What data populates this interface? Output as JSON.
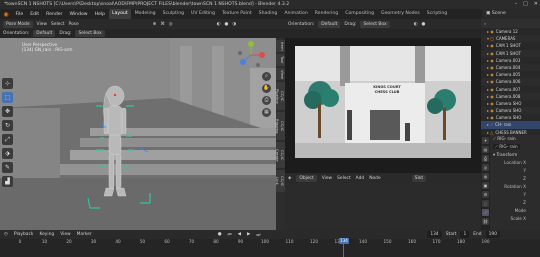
{
  "window": {
    "title": "*townSCN 1 NSHOTS [C:\\Users\\P\\Desktop\\snoal\\AOD\\FMP\\PROJECT FILES\\blender\\townSCN 1 NSHOTS.blend] - Blender 4.3.2",
    "controls": [
      "–",
      "□",
      "✕"
    ]
  },
  "menubar": {
    "items": [
      "File",
      "Edit",
      "Render",
      "Window",
      "Help"
    ],
    "workspaces": [
      "Layout",
      "Modeling",
      "Sculpting",
      "UV Editing",
      "Texture Paint",
      "Shading",
      "Animation",
      "Rendering",
      "Compositing",
      "Geometry Nodes",
      "Scripting"
    ],
    "active_workspace": "Layout",
    "scene_label": "Scene"
  },
  "viewport": {
    "mode": "Pose Mode",
    "menus": [
      "View",
      "Select",
      "Pose"
    ],
    "orientation_label": "Orientation:",
    "orientation_value": "Default",
    "drag_label": "Drag:",
    "drag_value": "Select Box",
    "info_line1": "User Perspective",
    "info_line2": "(134) GN_rain : RIG-arm",
    "n_tabs": [
      "Item",
      "Tool",
      "View",
      "CC/iC Pipeline",
      "CC/iC Rigging",
      "CC/iC Create",
      "CC/iC Link"
    ]
  },
  "camera_view": {
    "orientation_label": "Orientation:",
    "orientation_value": "Default",
    "drag_label": "Drag:",
    "drag_value": "Select Box",
    "sign_line1": "KINGS COURT",
    "sign_line2": "CHESS CLUB"
  },
  "node_editor": {
    "mode": "Object",
    "menus": [
      "View",
      "Select",
      "Add",
      "Node"
    ],
    "slot": "Slot"
  },
  "outliner": {
    "search_placeholder": "",
    "rows": [
      {
        "label": "Camera 12",
        "icon": "camera-icon"
      },
      {
        "label": "CAMERAS",
        "icon": "collection-icon"
      },
      {
        "label": "CAM 1 SHOT",
        "icon": "camera-icon"
      },
      {
        "label": "CAM 1 SHOT",
        "icon": "camera-icon"
      },
      {
        "label": "Camera.003",
        "icon": "camera-icon"
      },
      {
        "label": "Camera.004",
        "icon": "camera-icon"
      },
      {
        "label": "Camera.005",
        "icon": "camera-icon"
      },
      {
        "label": "Camera.006",
        "icon": "camera-icon"
      },
      {
        "label": "Camera.007",
        "icon": "camera-icon"
      },
      {
        "label": "Camera.008",
        "icon": "camera-icon"
      },
      {
        "label": "Camera SHO",
        "icon": "camera-icon"
      },
      {
        "label": "Camera SHO",
        "icon": "camera-icon"
      },
      {
        "label": "Camera SHO",
        "icon": "camera-icon"
      },
      {
        "label": "CH- rain",
        "icon": "armature-icon"
      },
      {
        "label": "CHESS BANNER",
        "icon": "mesh-icon"
      },
      {
        "label": "Cube.009",
        "icon": "mesh-icon"
      }
    ],
    "selected_index": 13
  },
  "properties": {
    "object_name": "RIG- rain",
    "bone_name": "RIG- rain",
    "section": "Transform",
    "rows": [
      "Location X",
      "Y",
      "Z",
      "Rotation X",
      "Y",
      "Z",
      "Mode",
      "Scale X"
    ]
  },
  "timeline": {
    "menus": [
      "Playback",
      "Keying",
      "View",
      "Marker"
    ],
    "current_frame": "134",
    "start_label": "Start",
    "start_value": "1",
    "end_label": "End",
    "end_value": "190",
    "ticks": [
      "0",
      "10",
      "20",
      "30",
      "40",
      "50",
      "60",
      "70",
      "80",
      "90",
      "100",
      "110",
      "120",
      "130",
      "140",
      "150",
      "160",
      "170",
      "180",
      "190"
    ]
  }
}
